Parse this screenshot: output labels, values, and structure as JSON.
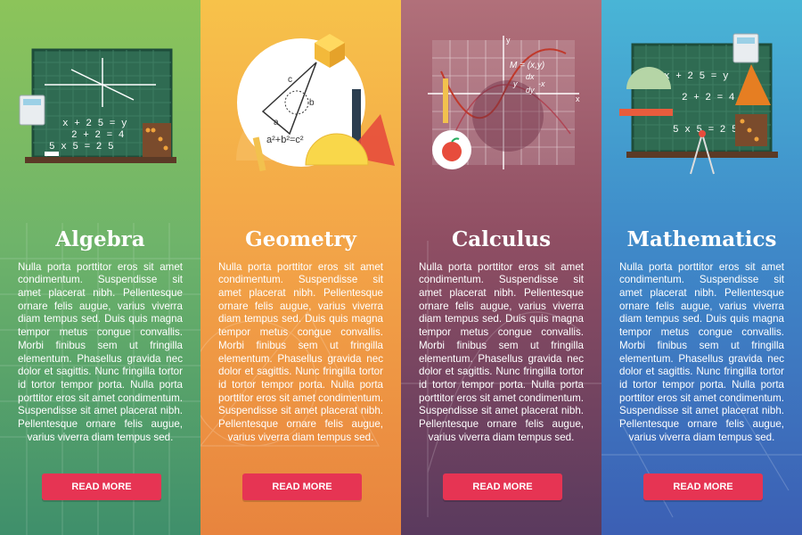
{
  "colors": {
    "algebra": "#7cbf62",
    "geometry": "#f3a548",
    "calculus": "#8f4e63",
    "mathematics": "#3f8ac9",
    "button": "#e63453"
  },
  "panels": [
    {
      "title": "Algebra",
      "body": "Nulla porta porttitor eros sit amet condimentum. Suspendisse sit amet placerat nibh. Pellentesque ornare felis augue, varius viverra diam tempus sed. Duis quis magna tempor metus congue convallis. Morbi finibus sem ut fringilla elementum. Phasellus gravida nec dolor et sagittis. Nunc fringilla tortor id tortor tempor porta. Nulla porta porttitor eros sit amet condimentum. Suspendisse sit amet placerat nibh. Pellentesque ornare felis augue, varius viverra diam tempus sed.",
      "button": "READ MORE",
      "art": {
        "line1": "x + 2 5 = y",
        "line2": "2 + 2 = 4",
        "line3": "5 x 5 = 2 5"
      }
    },
    {
      "title": "Geometry",
      "body": "Nulla porta porttitor eros sit amet condimentum. Suspendisse sit amet placerat nibh. Pellentesque ornare felis augue, varius viverra diam tempus sed. Duis quis magna tempor metus congue convallis. Morbi finibus sem ut fringilla elementum. Phasellus gravida nec dolor et sagittis. Nunc fringilla tortor id tortor tempor porta. Nulla porta porttitor eros sit amet condimentum. Suspendisse sit amet placerat nibh. Pellentesque ornare felis augue, varius viverra diam tempus sed.",
      "button": "READ MORE",
      "art": {
        "c": "c",
        "b": "b",
        "a": "a",
        "formula": "a²+b²=c²"
      }
    },
    {
      "title": "Calculus",
      "body": "Nulla porta porttitor eros sit amet condimentum. Suspendisse sit amet placerat nibh. Pellentesque ornare felis augue, varius viverra diam tempus sed. Duis quis magna tempor metus congue convallis. Morbi finibus sem ut fringilla elementum. Phasellus gravida nec dolor et sagittis. Nunc fringilla tortor id tortor tempor porta. Nulla porta porttitor eros sit amet condimentum. Suspendisse sit amet placerat nibh. Pellentesque ornare felis augue, varius viverra diam tempus sed.",
      "button": "READ MORE",
      "art": {
        "y": "y",
        "x": "x",
        "m": "M = (x,y)",
        "dx": "dx",
        "dy": "dy",
        "ylead": "y",
        "tail": "-x"
      }
    },
    {
      "title": "Mathematics",
      "body": "Nulla porta porttitor eros sit amet condimentum. Suspendisse sit amet placerat nibh. Pellentesque ornare felis augue, varius viverra diam tempus sed. Duis quis magna tempor metus congue convallis. Morbi finibus sem ut fringilla elementum. Phasellus gravida nec dolor et sagittis. Nunc fringilla tortor id tortor tempor porta. Nulla porta porttitor eros sit amet condimentum. Suspendisse sit amet placerat nibh. Pellentesque ornare felis augue, varius viverra diam tempus sed.",
      "button": "READ MORE",
      "art": {
        "line1": "x + 2 5 = y",
        "line2": "2 + 2 = 4",
        "line3": "5 x 5 = 2 5"
      }
    }
  ]
}
